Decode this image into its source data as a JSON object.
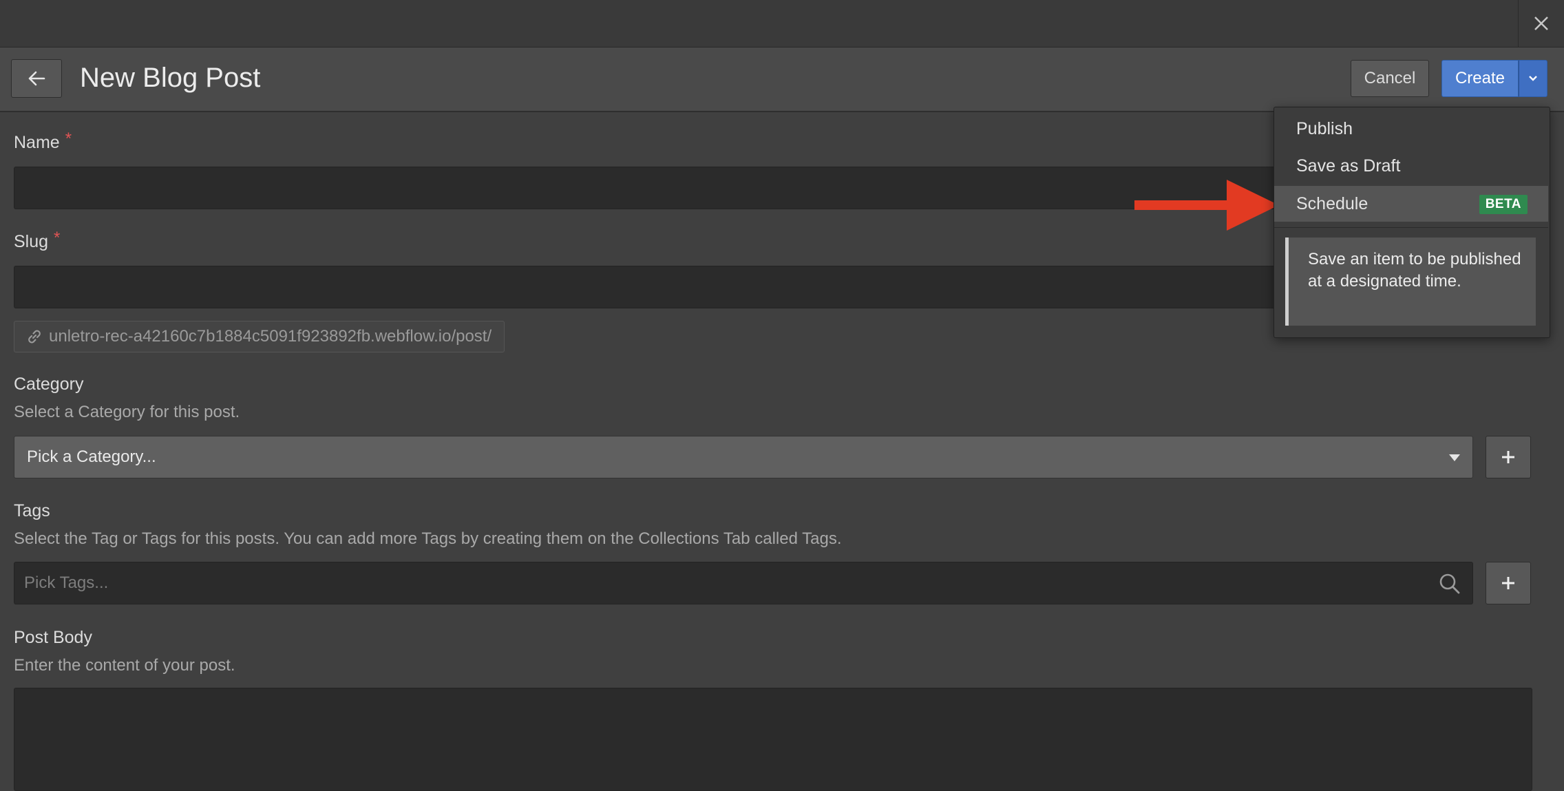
{
  "header": {
    "title": "New Blog Post",
    "cancel_label": "Cancel",
    "create_label": "Create"
  },
  "form": {
    "name": {
      "label": "Name",
      "required_mark": "*",
      "value": ""
    },
    "slug": {
      "label": "Slug",
      "required_mark": "*",
      "value": "",
      "url_hint": "unletro-rec-a42160c7b1884c5091f923892fb.webflow.io/post/"
    },
    "category": {
      "label": "Category",
      "help": "Select a Category for this post.",
      "selected": "Pick a Category...",
      "add_label": "+"
    },
    "tags": {
      "label": "Tags",
      "help": "Select the Tag or Tags for this posts. You can add more Tags by creating them on the Collections Tab called Tags.",
      "placeholder": "Pick Tags...",
      "add_label": "+"
    },
    "post_body": {
      "label": "Post Body",
      "help": "Enter the content of your post."
    }
  },
  "create_menu": {
    "items": [
      {
        "label": "Publish"
      },
      {
        "label": "Save as Draft"
      },
      {
        "label": "Schedule",
        "badge": "BETA",
        "active": true
      }
    ],
    "tooltip": "Save an item to be published at a designated time."
  },
  "colors": {
    "accent_blue": "#4f7fcf",
    "beta_green": "#2f8a4f",
    "annotation_arrow": "#e23a22",
    "required_red": "#e05555"
  },
  "icons": [
    "close-icon",
    "arrow-left-icon",
    "chevron-down-icon",
    "link-icon",
    "search-icon",
    "plus-icon"
  ]
}
